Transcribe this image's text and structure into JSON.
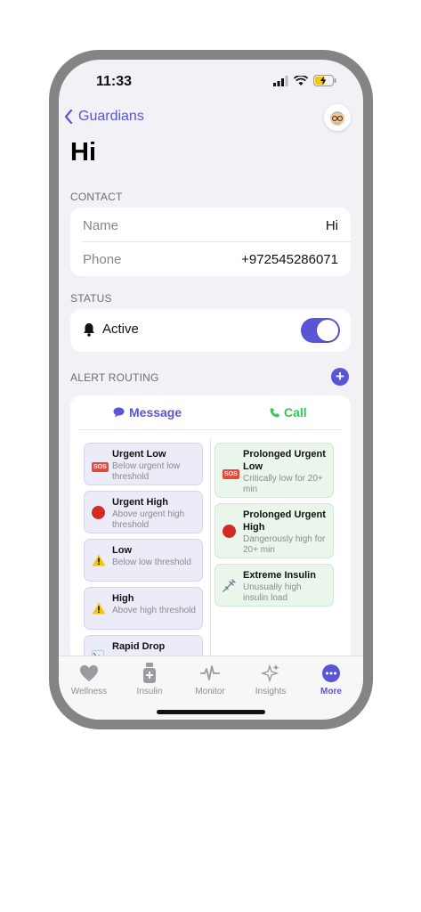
{
  "status_bar": {
    "time": "11:33"
  },
  "nav": {
    "back_label": "Guardians"
  },
  "page": {
    "title": "Hi"
  },
  "contact": {
    "section_label": "CONTACT",
    "name_label": "Name",
    "name_value": "Hi",
    "phone_label": "Phone",
    "phone_value": "+972545286071"
  },
  "status": {
    "section_label": "STATUS",
    "active_label": "Active",
    "active_on": true
  },
  "alert_routing": {
    "section_label": "ALERT ROUTING",
    "tab_message": "Message",
    "tab_call": "Call",
    "message_alerts": [
      {
        "title": "Urgent Low",
        "subtitle": "Below urgent low threshold",
        "icon": "sos-icon"
      },
      {
        "title": "Urgent High",
        "subtitle": "Above urgent high threshold",
        "icon": "red-circle-icon"
      },
      {
        "title": "Low",
        "subtitle": "Below low threshold",
        "icon": "warning-icon"
      },
      {
        "title": "High",
        "subtitle": "Above high threshold",
        "icon": "warning-icon"
      },
      {
        "title": "Rapid Drop",
        "subtitle": "",
        "icon": "trend-down-icon"
      }
    ],
    "call_alerts": [
      {
        "title": "Prolonged Urgent Low",
        "subtitle": "Critically low for 20+ min",
        "icon": "sos-icon"
      },
      {
        "title": "Prolonged Urgent High",
        "subtitle": "Dangerously high for 20+ min",
        "icon": "red-circle-icon"
      },
      {
        "title": "Extreme Insulin",
        "subtitle": "Unusually high insulin load",
        "icon": "syringe-icon"
      }
    ]
  },
  "tab_bar": {
    "items": [
      {
        "label": "Wellness",
        "icon": "heart-icon"
      },
      {
        "label": "Insulin",
        "icon": "insulin-vial-icon"
      },
      {
        "label": "Monitor",
        "icon": "waveform-icon"
      },
      {
        "label": "Insights",
        "icon": "sparkles-icon"
      },
      {
        "label": "More",
        "icon": "more-icon"
      }
    ],
    "active": "More",
    "accent": "#5856d6"
  }
}
